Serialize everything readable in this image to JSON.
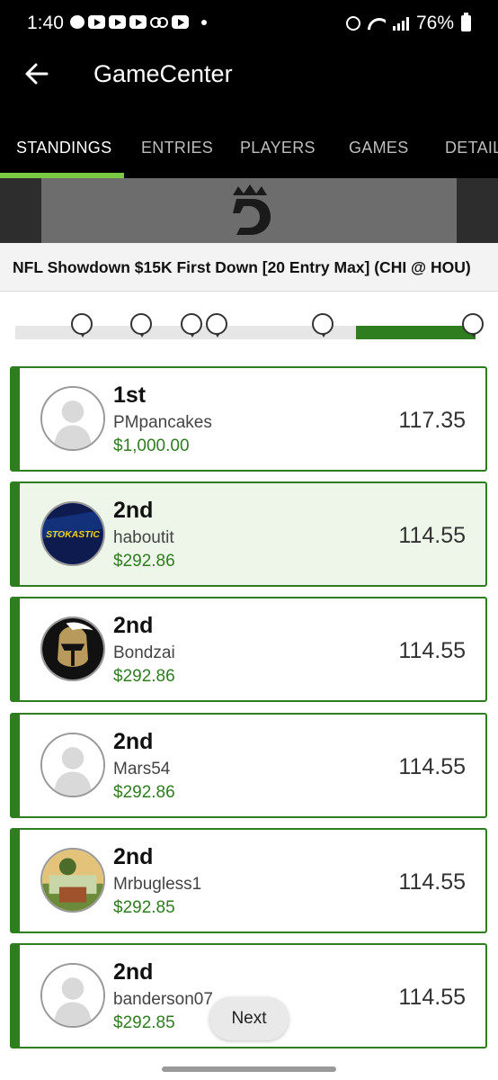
{
  "status_bar": {
    "time": "1:40",
    "battery": "76%"
  },
  "header": {
    "title": "GameCenter"
  },
  "tabs": [
    {
      "label": "STANDINGS",
      "active": true
    },
    {
      "label": "ENTRIES",
      "active": false
    },
    {
      "label": "PLAYERS",
      "active": false
    },
    {
      "label": "GAMES",
      "active": false
    },
    {
      "label": "DETAILS",
      "active": false
    }
  ],
  "contest": {
    "title": "NFL Showdown $15K First Down [20 Entry Max] (CHI @ HOU)"
  },
  "entries": [
    {
      "rank": "1st",
      "username": "PMpancakes",
      "prize": "$1,000.00",
      "score": "117.35",
      "avatar": "default-avatar-icon"
    },
    {
      "rank": "2nd",
      "username": "haboutit",
      "prize": "$292.86",
      "score": "114.55",
      "avatar": "stokastic-logo-avatar",
      "avatar_text": "STOKASTIC"
    },
    {
      "rank": "2nd",
      "username": "Bondzai",
      "prize": "$292.86",
      "score": "114.55",
      "avatar": "knight-helmet-avatar"
    },
    {
      "rank": "2nd",
      "username": "Mars54",
      "prize": "$292.86",
      "score": "114.55",
      "avatar": "default-avatar-icon"
    },
    {
      "rank": "2nd",
      "username": "Mrbugless1",
      "prize": "$292.85",
      "score": "114.55",
      "avatar": "illustrated-avatar"
    },
    {
      "rank": "2nd",
      "username": "banderson07",
      "prize": "$292.85",
      "score": "114.55",
      "avatar": "default-avatar-icon"
    }
  ],
  "pagination": {
    "next_label": "Next"
  },
  "colors": {
    "accent_green": "#7ac943",
    "prize_green": "#2e7d1f",
    "header_bg": "#000000"
  }
}
